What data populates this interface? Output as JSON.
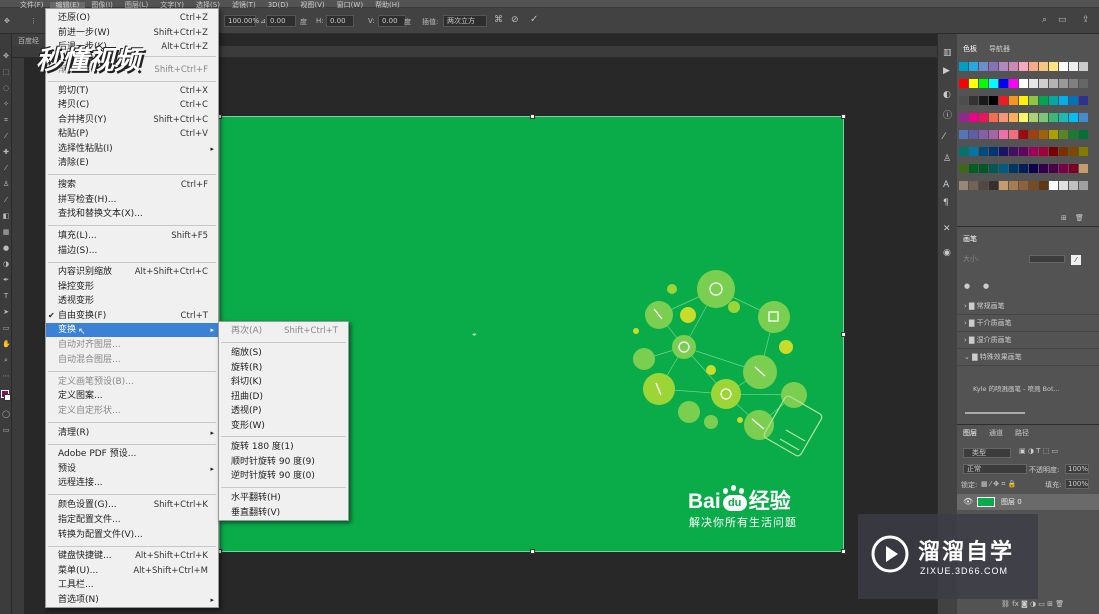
{
  "menubar": [
    "文件(F)",
    "编辑(E)",
    "图像(I)",
    "图层(L)",
    "文字(Y)",
    "选择(S)",
    "滤镜(T)",
    "3D(D)",
    "视图(V)",
    "窗口(W)",
    "帮助(H)"
  ],
  "options": {
    "w_percent": "100.00%",
    "angle": "0.00",
    "h_label": "H:",
    "h_value": "0.00",
    "v_label": "V:",
    "v_value": "0.00",
    "interp_label": "插值:",
    "interp_value": "两次立方",
    "unit1": "度",
    "unit2": "度"
  },
  "doc_tab": "百度经",
  "watermark_top": "秒懂视频",
  "edit_menu": [
    {
      "label": "还原(O)",
      "shortcut": "Ctrl+Z"
    },
    {
      "label": "前进一步(W)",
      "shortcut": "Shift+Ctrl+Z"
    },
    {
      "label": "后退一步(K)",
      "shortcut": "Alt+Ctrl+Z"
    },
    {
      "label": "渐隐(D)...",
      "shortcut": "Shift+Ctrl+F"
    },
    {
      "label": "剪切(T)",
      "shortcut": "Ctrl+X"
    },
    {
      "label": "拷贝(C)",
      "shortcut": "Ctrl+C"
    },
    {
      "label": "合并拷贝(Y)",
      "shortcut": "Shift+Ctrl+C"
    },
    {
      "label": "粘贴(P)",
      "shortcut": "Ctrl+V"
    },
    {
      "label": "选择性粘贴(I)",
      "shortcut": ""
    },
    {
      "label": "清除(E)",
      "shortcut": ""
    },
    {
      "label": "搜索",
      "shortcut": "Ctrl+F"
    },
    {
      "label": "拼写检查(H)...",
      "shortcut": ""
    },
    {
      "label": "查找和替换文本(X)...",
      "shortcut": ""
    },
    {
      "label": "填充(L)...",
      "shortcut": "Shift+F5"
    },
    {
      "label": "描边(S)...",
      "shortcut": ""
    },
    {
      "label": "内容识别缩放",
      "shortcut": "Alt+Shift+Ctrl+C"
    },
    {
      "label": "操控变形",
      "shortcut": ""
    },
    {
      "label": "透视变形",
      "shortcut": ""
    },
    {
      "label": "自由变换(F)",
      "shortcut": "Ctrl+T"
    },
    {
      "label": "变换",
      "shortcut": ""
    },
    {
      "label": "自动对齐图层...",
      "shortcut": ""
    },
    {
      "label": "自动混合图层...",
      "shortcut": ""
    },
    {
      "label": "定义画笔预设(B)...",
      "shortcut": ""
    },
    {
      "label": "定义图案...",
      "shortcut": ""
    },
    {
      "label": "定义自定形状...",
      "shortcut": ""
    },
    {
      "label": "清理(R)",
      "shortcut": ""
    },
    {
      "label": "Adobe PDF 预设...",
      "shortcut": ""
    },
    {
      "label": "预设",
      "shortcut": ""
    },
    {
      "label": "远程连接...",
      "shortcut": ""
    },
    {
      "label": "颜色设置(G)...",
      "shortcut": "Shift+Ctrl+K"
    },
    {
      "label": "指定配置文件...",
      "shortcut": ""
    },
    {
      "label": "转换为配置文件(V)...",
      "shortcut": ""
    },
    {
      "label": "键盘快捷键...",
      "shortcut": "Alt+Shift+Ctrl+K"
    },
    {
      "label": "菜单(U)...",
      "shortcut": "Alt+Shift+Ctrl+M"
    },
    {
      "label": "工具栏...",
      "shortcut": ""
    },
    {
      "label": "首选项(N)",
      "shortcut": ""
    }
  ],
  "transform_menu": [
    {
      "label": "再次(A)",
      "shortcut": "Shift+Ctrl+T"
    },
    {
      "label": "缩放(S)",
      "shortcut": ""
    },
    {
      "label": "旋转(R)",
      "shortcut": ""
    },
    {
      "label": "斜切(K)",
      "shortcut": ""
    },
    {
      "label": "扭曲(D)",
      "shortcut": ""
    },
    {
      "label": "透视(P)",
      "shortcut": ""
    },
    {
      "label": "变形(W)",
      "shortcut": ""
    },
    {
      "label": "旋转 180 度(1)",
      "shortcut": ""
    },
    {
      "label": "顺时针旋转 90 度(9)",
      "shortcut": ""
    },
    {
      "label": "逆时针旋转 90 度(0)",
      "shortcut": ""
    },
    {
      "label": "水平翻转(H)",
      "shortcut": ""
    },
    {
      "label": "垂直翻转(V)",
      "shortcut": ""
    }
  ],
  "canvas": {
    "brand": "Bai",
    "brand_du": "du",
    "brand_cn": "经验",
    "slogan": "解决你所有生活问题",
    "bg_color": "#0aac4a"
  },
  "right_panel": {
    "tabs_top": [
      "色板",
      "导航器"
    ],
    "brush_tab": "画笔",
    "size_label": "大小:",
    "brush_groups": [
      "常规画笔",
      "干介质画笔",
      "湿介质画笔",
      "特殊效果画笔"
    ],
    "brush_item": "Kyle 的喷溅画笔 - 喷溅 Bot...",
    "layer_tabs": [
      "图层",
      "通道",
      "路径"
    ],
    "kind_label": "类型",
    "blend_mode": "正常",
    "opacity_label": "不透明度:",
    "opacity_value": "100%",
    "lock_label": "锁定:",
    "fill_label": "填充:",
    "fill_value": "100%",
    "layer_name": "图层 0"
  },
  "brand_watermark": {
    "title": "溜溜自学",
    "url": "ZIXUE.3D66.COM"
  }
}
